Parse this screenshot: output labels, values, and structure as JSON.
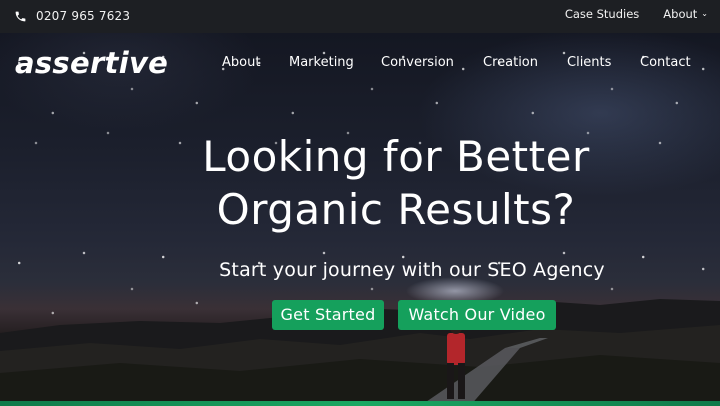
{
  "topbar": {
    "phone_icon": "phone-icon",
    "phone": "0207 965 7623",
    "links": [
      {
        "label": "Case Studies"
      },
      {
        "label": "About",
        "icon": "chevron-down-icon"
      }
    ]
  },
  "header": {
    "logo": "assertive",
    "nav": [
      {
        "label": "About"
      },
      {
        "label": "Marketing"
      },
      {
        "label": "Conversion"
      },
      {
        "label": "Creation"
      },
      {
        "label": "Clients"
      },
      {
        "label": "Contact"
      }
    ]
  },
  "hero": {
    "headline_line1": "Looking for Better",
    "headline_line2": "Organic Results?",
    "subheadline": "Start your journey with our SEO Agency",
    "primary_button": "Get Started",
    "secondary_button": "Watch Our Video"
  },
  "colors": {
    "accent_green": "#15a05c",
    "topbar_bg": "#1d1f23"
  }
}
